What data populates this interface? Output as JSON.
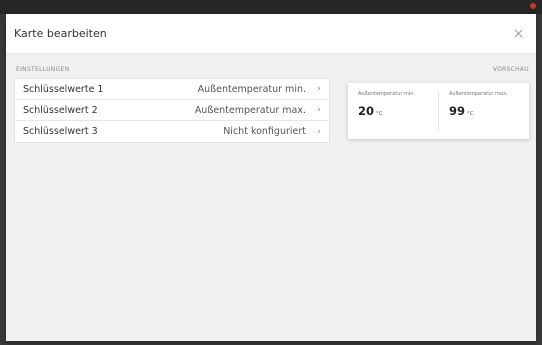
{
  "dialog": {
    "title": "Karte bearbeiten",
    "close_icon": "close-icon"
  },
  "settings": {
    "section_label": "EINSTELLUNGEN",
    "rows": [
      {
        "label": "Schlüsselwerte 1",
        "value": "Außentemperatur min.",
        "chevron": "›"
      },
      {
        "label": "Schlüsselwert 2",
        "value": "Außentemperatur max.",
        "chevron": "›"
      },
      {
        "label": "Schlüsselwert 3",
        "value": "Nicht konfiguriert",
        "chevron": "›"
      }
    ]
  },
  "preview": {
    "section_label": "VORSCHAU",
    "items": [
      {
        "label": "Außentemperatur min.",
        "value": "20",
        "unit": "°C"
      },
      {
        "label": "Außentemperatur max.",
        "value": "99",
        "unit": "°C"
      }
    ]
  },
  "colors": {
    "backdrop": "#3a3a3a",
    "dialog_background": "#f1f1f1",
    "card_background": "#ffffff",
    "accent_dot": "#c0392b"
  }
}
